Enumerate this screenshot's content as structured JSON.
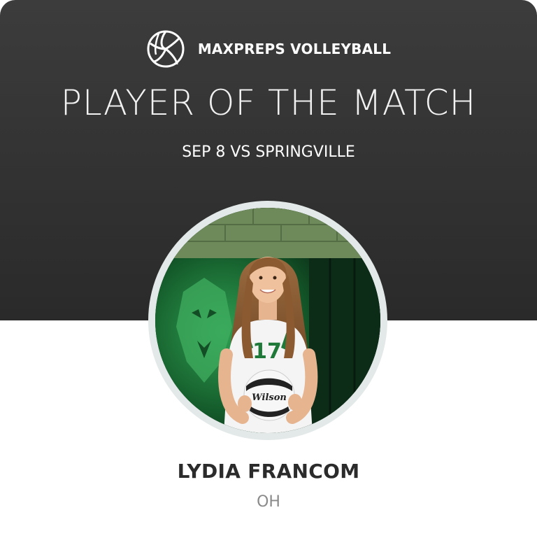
{
  "brand": {
    "name": "MAXPREPS VOLLEYBALL",
    "logo_icon": "volleyball-icon"
  },
  "title": "PLAYER OF THE MATCH",
  "match": "SEP 8 VS SPRINGVILLE",
  "player": {
    "name": "LYDIA FRANCOM",
    "position": "OH",
    "photo_icon": "player-photo",
    "jersey_number": "17"
  },
  "colors": {
    "header_bg": "#2f2f2f",
    "ring": "#e3e9e8",
    "name_text": "#2b2b2b",
    "position_text": "#8a8a8a",
    "team_green": "#1f7a3a"
  }
}
